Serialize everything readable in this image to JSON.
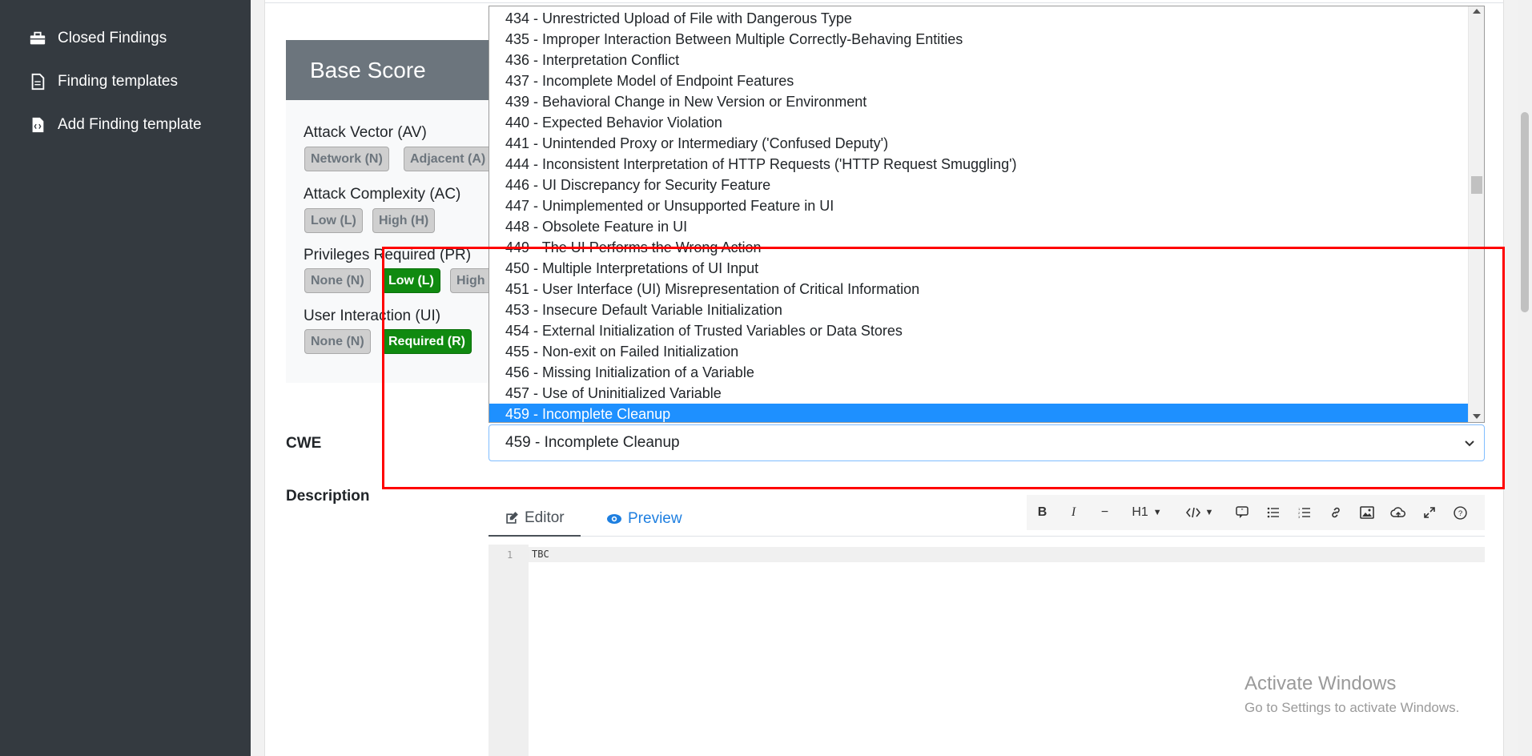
{
  "sidebar": {
    "items": [
      {
        "label": "Closed Findings",
        "icon": "toolbox-icon"
      },
      {
        "label": "Finding templates",
        "icon": "document-icon"
      },
      {
        "label": "Add Finding template",
        "icon": "code-file-icon"
      }
    ]
  },
  "base_score": {
    "title": "Base Score",
    "metrics": [
      {
        "label": "Attack Vector (AV)",
        "options": [
          "Network (N)",
          "Adjacent (A)"
        ]
      },
      {
        "label": "Attack Complexity (AC)",
        "options": [
          "Low (L)",
          "High (H)"
        ]
      },
      {
        "label": "Privileges Required (PR)",
        "options": [
          "None (N)",
          "Low (L)",
          "High"
        ],
        "selected": "Low (L)"
      },
      {
        "label": "User Interaction (UI)",
        "options": [
          "None (N)",
          "Required (R)"
        ],
        "selected": "Required (R)"
      }
    ]
  },
  "cwe": {
    "label": "CWE",
    "selected": "459 - Incomplete Cleanup",
    "options": [
      "434 - Unrestricted Upload of File with Dangerous Type",
      "435 - Improper Interaction Between Multiple Correctly-Behaving Entities",
      "436 - Interpretation Conflict",
      "437 - Incomplete Model of Endpoint Features",
      "439 - Behavioral Change in New Version or Environment",
      "440 - Expected Behavior Violation",
      "441 - Unintended Proxy or Intermediary ('Confused Deputy')",
      "444 - Inconsistent Interpretation of HTTP Requests ('HTTP Request Smuggling')",
      "446 - UI Discrepancy for Security Feature",
      "447 - Unimplemented or Unsupported Feature in UI",
      "448 - Obsolete Feature in UI",
      "449 - The UI Performs the Wrong Action",
      "450 - Multiple Interpretations of UI Input",
      "451 - User Interface (UI) Misrepresentation of Critical Information",
      "453 - Insecure Default Variable Initialization",
      "454 - External Initialization of Trusted Variables or Data Stores",
      "455 - Non-exit on Failed Initialization",
      "456 - Missing Initialization of a Variable",
      "457 - Use of Uninitialized Variable",
      "459 - Incomplete Cleanup"
    ]
  },
  "description": {
    "label": "Description",
    "tabs": {
      "editor": "Editor",
      "preview": "Preview"
    },
    "toolbar": {
      "heading": "H1"
    },
    "line_number": "1",
    "content": "TBC"
  },
  "watermark": {
    "line1": "Activate Windows",
    "line2": "Go to Settings to activate Windows."
  },
  "colors": {
    "sidebar": "#343a40",
    "selected_metric": "#108a10",
    "selected_option": "#1e90ff",
    "highlight": "#ff0000"
  }
}
